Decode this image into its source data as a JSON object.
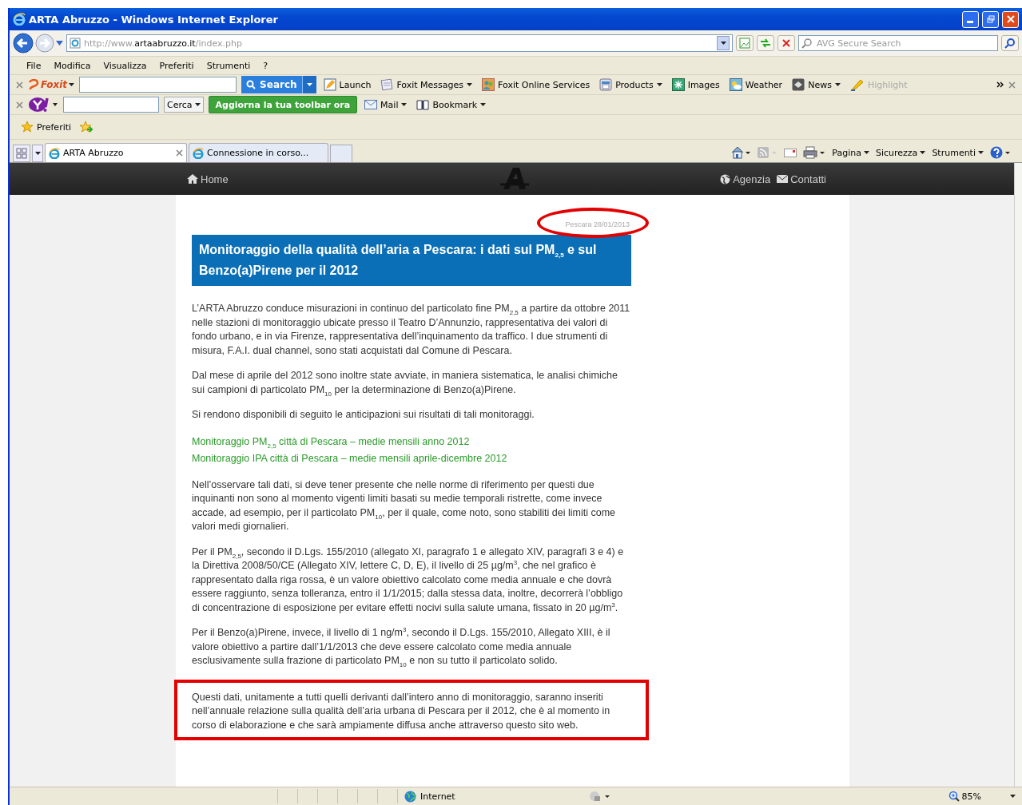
{
  "window": {
    "title": "ARTA Abruzzo - Windows Internet Explorer"
  },
  "address": {
    "url_prefix": "http://www.",
    "url_domain": "artaabruzzo.it",
    "url_path": "/index.php"
  },
  "search": {
    "placeholder": "AVG Secure Search"
  },
  "menu": [
    "File",
    "Modifica",
    "Visualizza",
    "Preferiti",
    "Strumenti",
    "?"
  ],
  "foxit_toolbar": {
    "brand": "Foxit",
    "search_button": "Search",
    "items": [
      {
        "label": "Launch",
        "dropdown": false,
        "disabled": false
      },
      {
        "label": "Foxit Messages",
        "dropdown": true,
        "disabled": false
      },
      {
        "label": "Foxit Online Services",
        "dropdown": false,
        "disabled": false
      },
      {
        "label": "Products",
        "dropdown": true,
        "disabled": false
      },
      {
        "label": "Images",
        "dropdown": false,
        "disabled": false
      },
      {
        "label": "Weather",
        "dropdown": false,
        "disabled": false
      },
      {
        "label": "News",
        "dropdown": true,
        "disabled": false
      },
      {
        "label": "Highlight",
        "dropdown": false,
        "disabled": true
      }
    ]
  },
  "yahoo_toolbar": {
    "search_button": "Cerca",
    "update_button": "Aggiorna la tua toolbar ora",
    "items": [
      {
        "label": "Mail",
        "dropdown": true
      },
      {
        "label": "Bookmark",
        "dropdown": true
      }
    ]
  },
  "favorites_bar": {
    "label": "Preferiti"
  },
  "tabs": [
    {
      "label": "ARTA Abruzzo",
      "selected": true
    },
    {
      "label": "Connessione in corso...",
      "selected": false
    }
  ],
  "command_bar": [
    "Pagina",
    "Sicurezza",
    "Strumenti"
  ],
  "site_nav": {
    "left": [
      "Home"
    ],
    "right": [
      "Agenzia",
      "Contatti"
    ]
  },
  "article": {
    "date": "Pescara 28/01/2013",
    "date_circled": true,
    "title": "Monitoraggio della qualità dell’aria a Pescara: i dati sul PM$_{2,5}$ e sul Benzo(a)Pirene per il 2012",
    "blocks": [
      {
        "kind": "paragraph",
        "highlighted": false,
        "text": "L’ARTA Abruzzo conduce misurazioni in continuo del particolato fine PM$_{2,5}$ a partire da ottobre 2011 nelle stazioni di monitoraggio ubicate presso il Teatro D’Annunzio, rappresentativa dei valori di fondo urbano, e in via Firenze, rappresentativa dell’inquinamento da traffico. I due strumenti di misura, F.A.I. dual channel, sono stati acquistati dal Comune di Pescara."
      },
      {
        "kind": "paragraph",
        "highlighted": false,
        "text": "Dal mese di aprile del 2012 sono inoltre state avviate, in maniera sistematica, le analisi chimiche sui campioni di particolato PM$_{10}$ per la determinazione di Benzo(a)Pirene."
      },
      {
        "kind": "paragraph",
        "highlighted": false,
        "text": "Si rendono disponibili di seguito le anticipazioni sui risultati di tali monitoraggi."
      },
      {
        "kind": "links",
        "highlighted": false,
        "items": [
          "Monitoraggio PM$_{2,5}$ città di Pescara – medie mensili anno 2012",
          "Monitoraggio IPA città di Pescara – medie mensili aprile-dicembre 2012"
        ]
      },
      {
        "kind": "paragraph",
        "highlighted": false,
        "text": "Nell’osservare tali dati, si deve tener presente che nelle norme di riferimento per questi due inquinanti non sono al momento vigenti limiti basati su medie temporali ristrette, come invece accade, ad esempio, per il particolato PM$_{10}$, per il quale, come noto, sono stabiliti dei limiti come valori medi giornalieri."
      },
      {
        "kind": "paragraph",
        "highlighted": false,
        "text": "Per il PM$_{2,5}$, secondo il D.Lgs. 155/2010 (allegato XI, paragrafo 1 e allegato XIV, paragrafi 3 e 4) e la Direttiva 2008/50/CE (Allegato XIV, lettere C, D, E), il livello di 25 µg/m$^{3}$, che nel grafico è rappresentato dalla riga rossa, è un valore obiettivo calcolato come media annuale e che dovrà essere raggiunto, senza tolleranza, entro il 1/1/2015; dalla stessa data, inoltre, decorrerà l’obbligo di concentrazione di esposizione per evitare effetti nocivi sulla salute umana, fissato in 20 µg/m$^{3}$."
      },
      {
        "kind": "paragraph",
        "highlighted": false,
        "text": "Per il Benzo(a)Pirene, invece, il livello di 1 ng/m$^{3}$, secondo il D.Lgs. 155/2010, Allegato XIII, è il valore obiettivo a partire dall’1/1/2013 che deve essere calcolato come media annuale esclusivamente sulla frazione di particolato PM$_{10}$ e non su tutto il particolato solido."
      },
      {
        "kind": "paragraph",
        "highlighted": true,
        "text": "Questi dati, unitamente a tutti quelli derivanti dall’intero anno di monitoraggio, saranno inseriti nell’annuale relazione sulla qualità dell’aria urbana di Pescara per il 2012, che è al momento in corso di elaborazione e che sarà ampiamente diffusa anche attraverso questo sito web."
      }
    ]
  },
  "status_bar": {
    "zone": "Internet",
    "zoom": "85%"
  }
}
